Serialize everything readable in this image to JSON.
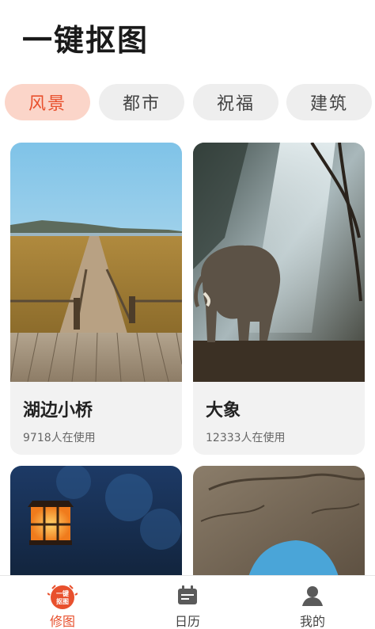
{
  "app": {
    "title": "一键抠图"
  },
  "categories": {
    "items": [
      {
        "label": "风景",
        "active": true
      },
      {
        "label": "都市",
        "active": false
      },
      {
        "label": "祝福",
        "active": false
      },
      {
        "label": "建筑",
        "active": false
      }
    ]
  },
  "cards": [
    {
      "name": "湖边小桥",
      "usage": "9718人在使用"
    },
    {
      "name": "大象",
      "usage": "12333人在使用"
    }
  ],
  "tabbar": {
    "items": [
      {
        "label": "修图",
        "icon": "retouch-icon",
        "badge": "一键抠图",
        "active": true
      },
      {
        "label": "日历",
        "icon": "calendar-icon",
        "active": false
      },
      {
        "label": "我的",
        "icon": "user-icon",
        "active": false
      }
    ]
  },
  "colors": {
    "accent": "#e8502d",
    "accent_bg": "#fbd5c9",
    "chip_bg": "#eeeeee"
  }
}
